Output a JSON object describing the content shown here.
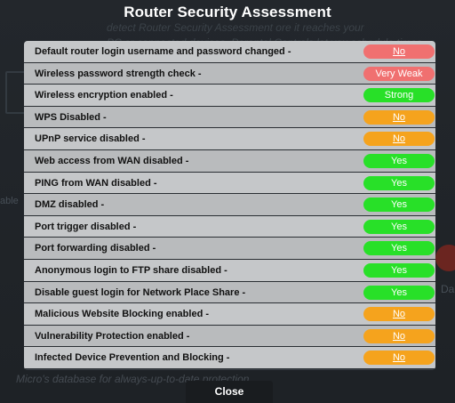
{
  "modal": {
    "title": "Router Security Assessment",
    "close_label": "Close"
  },
  "background": {
    "line1": "detect Router Security Assessment ore it reaches your",
    "line2": "PC or connected devices. Parental Controls let you schedule times",
    "bottom_line": "Micro's database for always-up-to-date protection.",
    "side_left": "able",
    "side_right": "Da"
  },
  "colors": {
    "no": "#f5a31d",
    "very_weak": "#f07070",
    "red_no": "#f07070",
    "good": "#28e028"
  },
  "items": [
    {
      "label": "Default router login username and password changed -",
      "status": "No",
      "kind": "red_no",
      "link": true
    },
    {
      "label": "Wireless password strength check -",
      "status": "Very Weak",
      "kind": "very_weak",
      "link": false
    },
    {
      "label": "Wireless encryption enabled -",
      "status": "Strong",
      "kind": "good",
      "link": false
    },
    {
      "label": "WPS Disabled -",
      "status": "No",
      "kind": "no",
      "link": true
    },
    {
      "label": "UPnP service disabled -",
      "status": "No",
      "kind": "no",
      "link": true
    },
    {
      "label": "Web access from WAN disabled -",
      "status": "Yes",
      "kind": "good",
      "link": false
    },
    {
      "label": "PING from WAN disabled -",
      "status": "Yes",
      "kind": "good",
      "link": false
    },
    {
      "label": "DMZ disabled -",
      "status": "Yes",
      "kind": "good",
      "link": false
    },
    {
      "label": "Port trigger disabled -",
      "status": "Yes",
      "kind": "good",
      "link": false
    },
    {
      "label": "Port forwarding disabled -",
      "status": "Yes",
      "kind": "good",
      "link": false
    },
    {
      "label": "Anonymous login to FTP share disabled -",
      "status": "Yes",
      "kind": "good",
      "link": false
    },
    {
      "label": "Disable guest login for Network Place Share -",
      "status": "Yes",
      "kind": "good",
      "link": false
    },
    {
      "label": "Malicious Website Blocking enabled -",
      "status": "No",
      "kind": "no",
      "link": true
    },
    {
      "label": "Vulnerability Protection enabled -",
      "status": "No",
      "kind": "no",
      "link": true
    },
    {
      "label": "Infected Device Prevention and Blocking -",
      "status": "No",
      "kind": "no",
      "link": true
    }
  ]
}
